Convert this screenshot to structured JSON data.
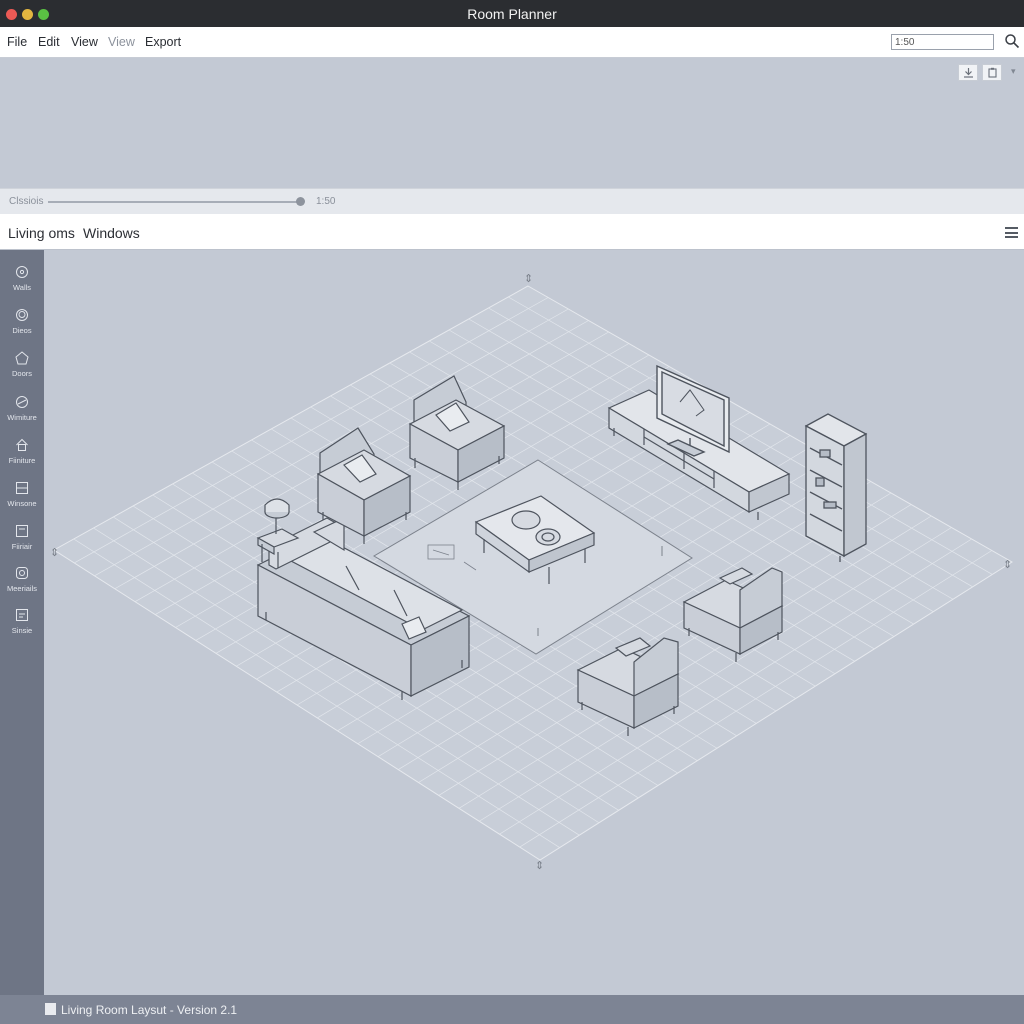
{
  "window": {
    "title": "Room Planner"
  },
  "menu": {
    "items": [
      "File",
      "Edit",
      "View",
      "View",
      "Export"
    ],
    "zoom_value": "1:50"
  },
  "toolbar": {
    "icons": [
      "download-icon",
      "copy-icon",
      "chevron-down-icon"
    ]
  },
  "slider": {
    "label": "Clssiois",
    "value_label": "1:50",
    "level": 1.0
  },
  "tabs": [
    "Living oms",
    "Windows"
  ],
  "sidebar": {
    "items": [
      {
        "label": "Walls",
        "icon": "walls-icon"
      },
      {
        "label": "Dieos",
        "icon": "circle-icon"
      },
      {
        "label": "Doors",
        "icon": "door-icon"
      },
      {
        "label": "Wimiture",
        "icon": "compass-icon"
      },
      {
        "label": "Fiiniture",
        "icon": "house-icon"
      },
      {
        "label": "Winsone",
        "icon": "window-icon"
      },
      {
        "label": "Fiiriair",
        "icon": "frame-icon"
      },
      {
        "label": "Meeriails",
        "icon": "materials-icon"
      },
      {
        "label": "Sinsie",
        "icon": "settings-icon"
      }
    ]
  },
  "status": {
    "text": "Living Room Laysut - Version 2.1"
  },
  "colors": {
    "titlebar": "#2b2d31",
    "sidebar": "#6e7585",
    "canvas": "#c3c9d4",
    "status": "#7d8494",
    "furniture": "#d6dae1"
  }
}
